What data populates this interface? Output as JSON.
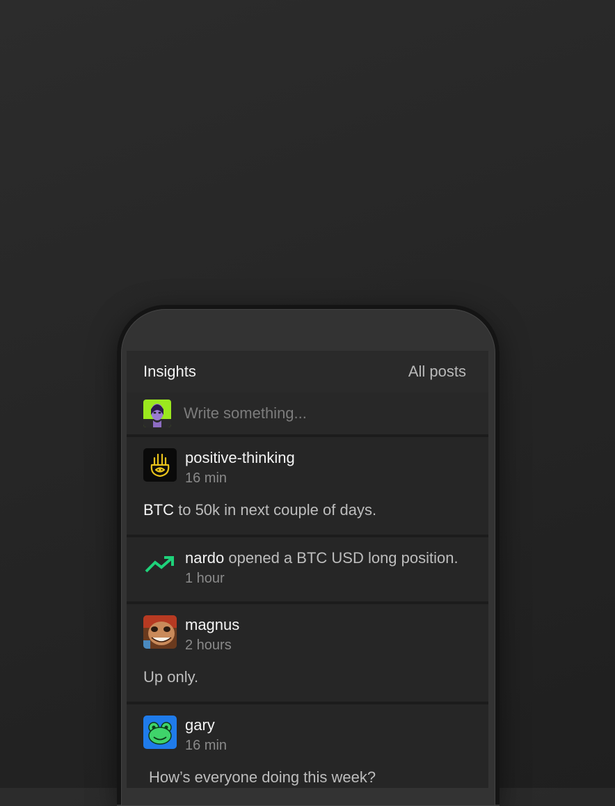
{
  "header": {
    "title": "Insights",
    "all_posts": "All posts"
  },
  "compose": {
    "placeholder": "Write something..."
  },
  "posts": [
    {
      "author": "positive-thinking",
      "time": "16 min",
      "ticker": "BTC",
      "text": " to 50k in next couple of days."
    },
    {
      "author": "nardo",
      "action": " opened a BTC USD long position.",
      "time": "1 hour",
      "icon": "trending-up-icon"
    },
    {
      "author": "magnus",
      "time": "2 hours",
      "text": "Up only."
    },
    {
      "author": "gary",
      "time": "16 min",
      "text": "How’s everyone doing this week?"
    }
  ],
  "colors": {
    "trend": "#1ed27a",
    "hamsa": "#e8c21a"
  }
}
